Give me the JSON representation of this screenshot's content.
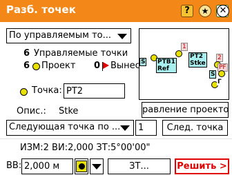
{
  "app": {
    "title": "Разб. точек",
    "accent_color": "#f38818"
  },
  "titlebar_icons": [
    {
      "name": "help-icon",
      "glyph": "?"
    },
    {
      "name": "star-icon",
      "glyph": "★"
    },
    {
      "name": "checklist-icon",
      "glyph": "✓"
    },
    {
      "name": "close-icon",
      "glyph": "✕"
    }
  ],
  "filter": {
    "selected": "По управляемым то..."
  },
  "stats": {
    "managed_count": "6",
    "managed_label": "Управляемые точки",
    "design_count": "6",
    "design_label": "Проект",
    "staked_count": "0",
    "staked_label": "Вынесе"
  },
  "map": {
    "labels": [
      "1",
      "PT2",
      "Stke",
      "2",
      "PF",
      "S",
      "PTB1",
      "Ref",
      "S",
      "Г"
    ]
  },
  "point": {
    "label": "Точка:",
    "value": "PT2",
    "desc_label": "Опис.:",
    "desc_value": "Stke"
  },
  "buttons": {
    "design_direction": "равление проектоі",
    "next_point": "След. точка",
    "zt": "ЗТ...",
    "solve": "Решить >"
  },
  "next_mode": {
    "selected": "Следующая точка по ...",
    "step": "1"
  },
  "status": {
    "line": "ИЗМ:2  ВИ:2,000  ЗТ:5°00'00\""
  },
  "bottom": {
    "vv_label": "ВВ:",
    "vv_value": "2,000 м"
  }
}
